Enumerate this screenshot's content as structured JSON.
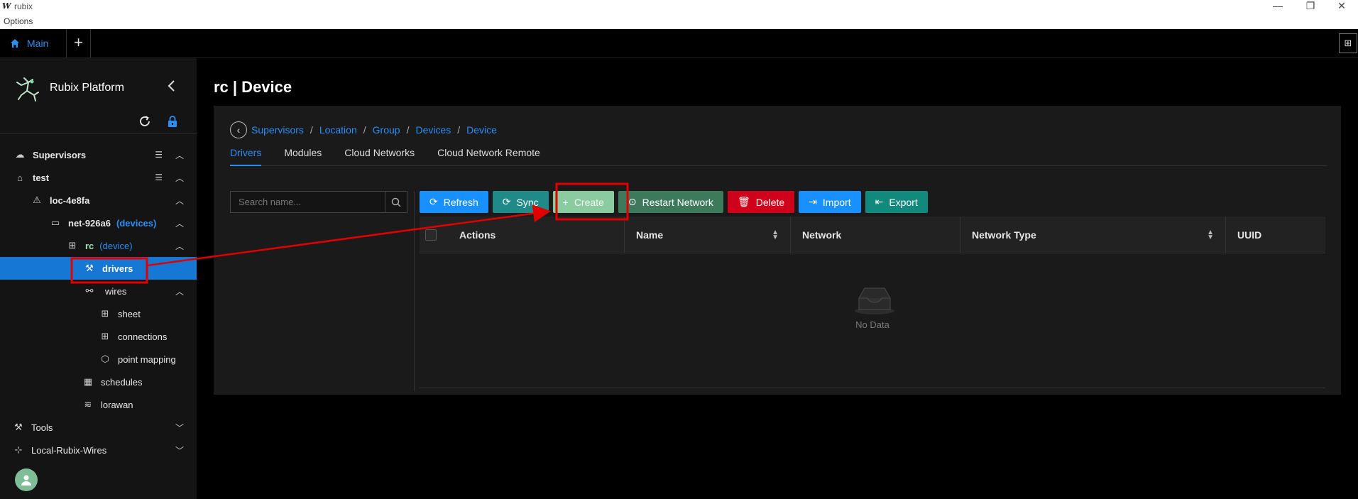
{
  "window": {
    "logo_glyph": "W",
    "title": "rubix",
    "menu": "Options",
    "minimize": "—",
    "restore": "❐",
    "close": "✕"
  },
  "tabbar": {
    "main_tab": "Main",
    "add_tab": "+",
    "right_icon": "⊞"
  },
  "sidebar": {
    "brand": "Rubix Platform",
    "items": [
      {
        "label": "Supervisors",
        "tag": ""
      },
      {
        "label": "test",
        "tag": ""
      },
      {
        "label": "loc-4e8fa",
        "tag": ""
      },
      {
        "label": "net-926a6",
        "tag": "(devices)"
      },
      {
        "label": "rc",
        "tag": "(device)"
      },
      {
        "label": "drivers",
        "tag": ""
      },
      {
        "label": "wires",
        "tag": ""
      },
      {
        "label": "sheet",
        "tag": ""
      },
      {
        "label": "connections",
        "tag": ""
      },
      {
        "label": "point mapping",
        "tag": ""
      },
      {
        "label": "schedules",
        "tag": ""
      },
      {
        "label": "lorawan",
        "tag": ""
      },
      {
        "label": "Tools",
        "tag": ""
      },
      {
        "label": "Local-Rubix-Wires",
        "tag": ""
      }
    ]
  },
  "main": {
    "title": "rc | Device",
    "breadcrumbs": [
      "Supervisors",
      "Location",
      "Group",
      "Devices",
      "Device"
    ],
    "crumb_sep": "/",
    "tabs": [
      "Drivers",
      "Modules",
      "Cloud Networks",
      "Cloud Network Remote"
    ],
    "search_placeholder": "Search name...",
    "buttons": {
      "refresh": "Refresh",
      "sync": "Sync",
      "create": "Create",
      "restart": "Restart Network",
      "delete": "Delete",
      "import": "Import",
      "export": "Export"
    },
    "table": {
      "columns": [
        "Actions",
        "Name",
        "Network",
        "Network Type",
        "UUID"
      ],
      "empty_text": "No Data"
    }
  },
  "colors": {
    "accent": "#1677d4",
    "link": "#2b8ef5",
    "refresh": "#1890ff",
    "sync": "#1f8a87",
    "create": "#8bcba0",
    "restart": "#3d7a5c",
    "delete": "#d0021b",
    "import": "#1890ff",
    "export": "#11897d",
    "annotation": "#e00000"
  }
}
